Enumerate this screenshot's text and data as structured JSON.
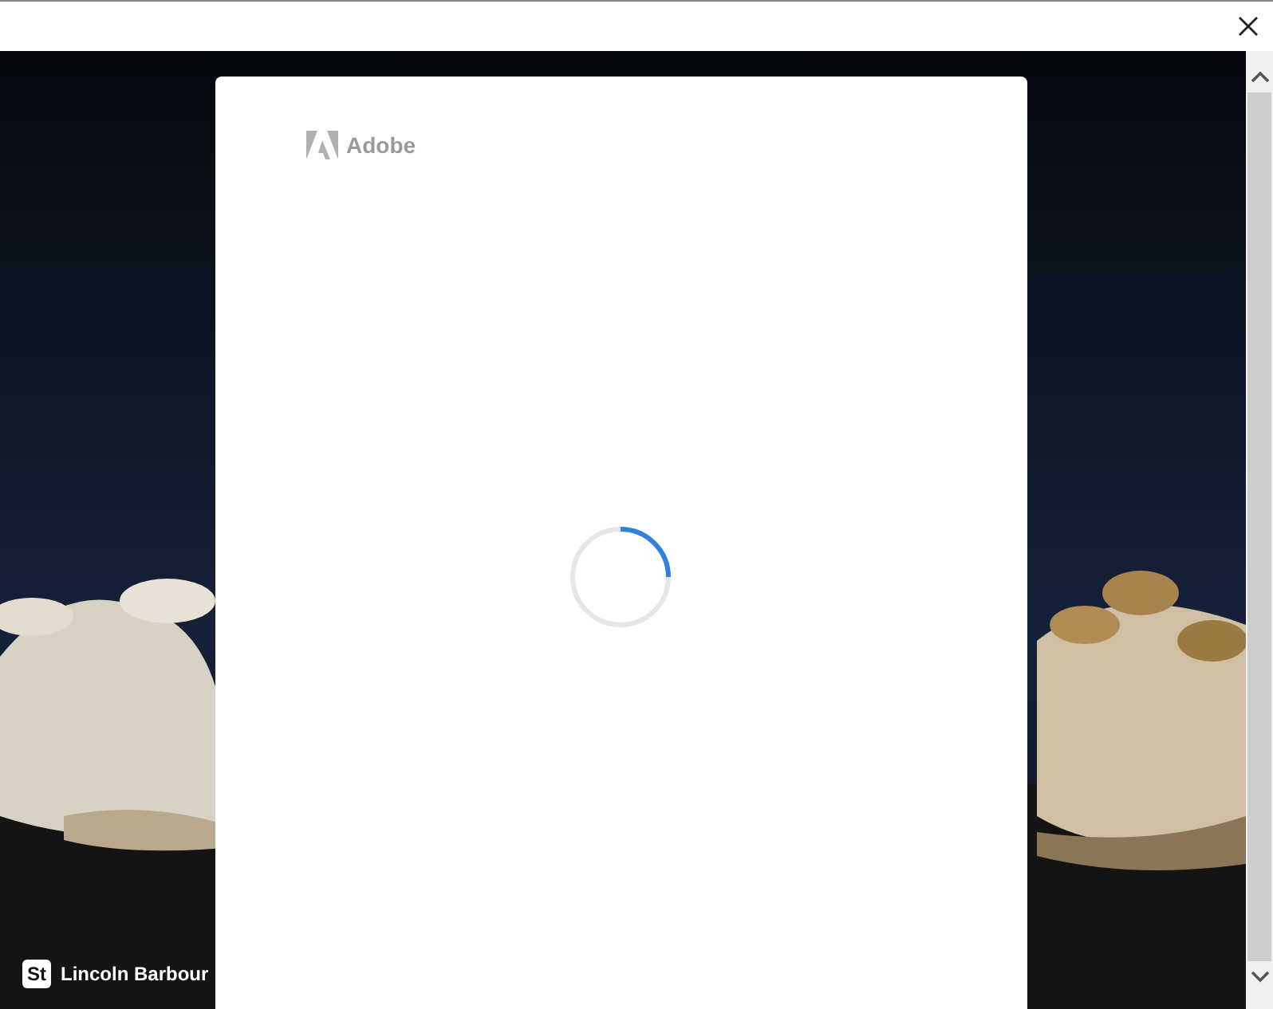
{
  "dialog": {
    "logo": {
      "text": "Adobe"
    }
  },
  "credit": {
    "badge": "St",
    "name": "Lincoln Barbour"
  }
}
